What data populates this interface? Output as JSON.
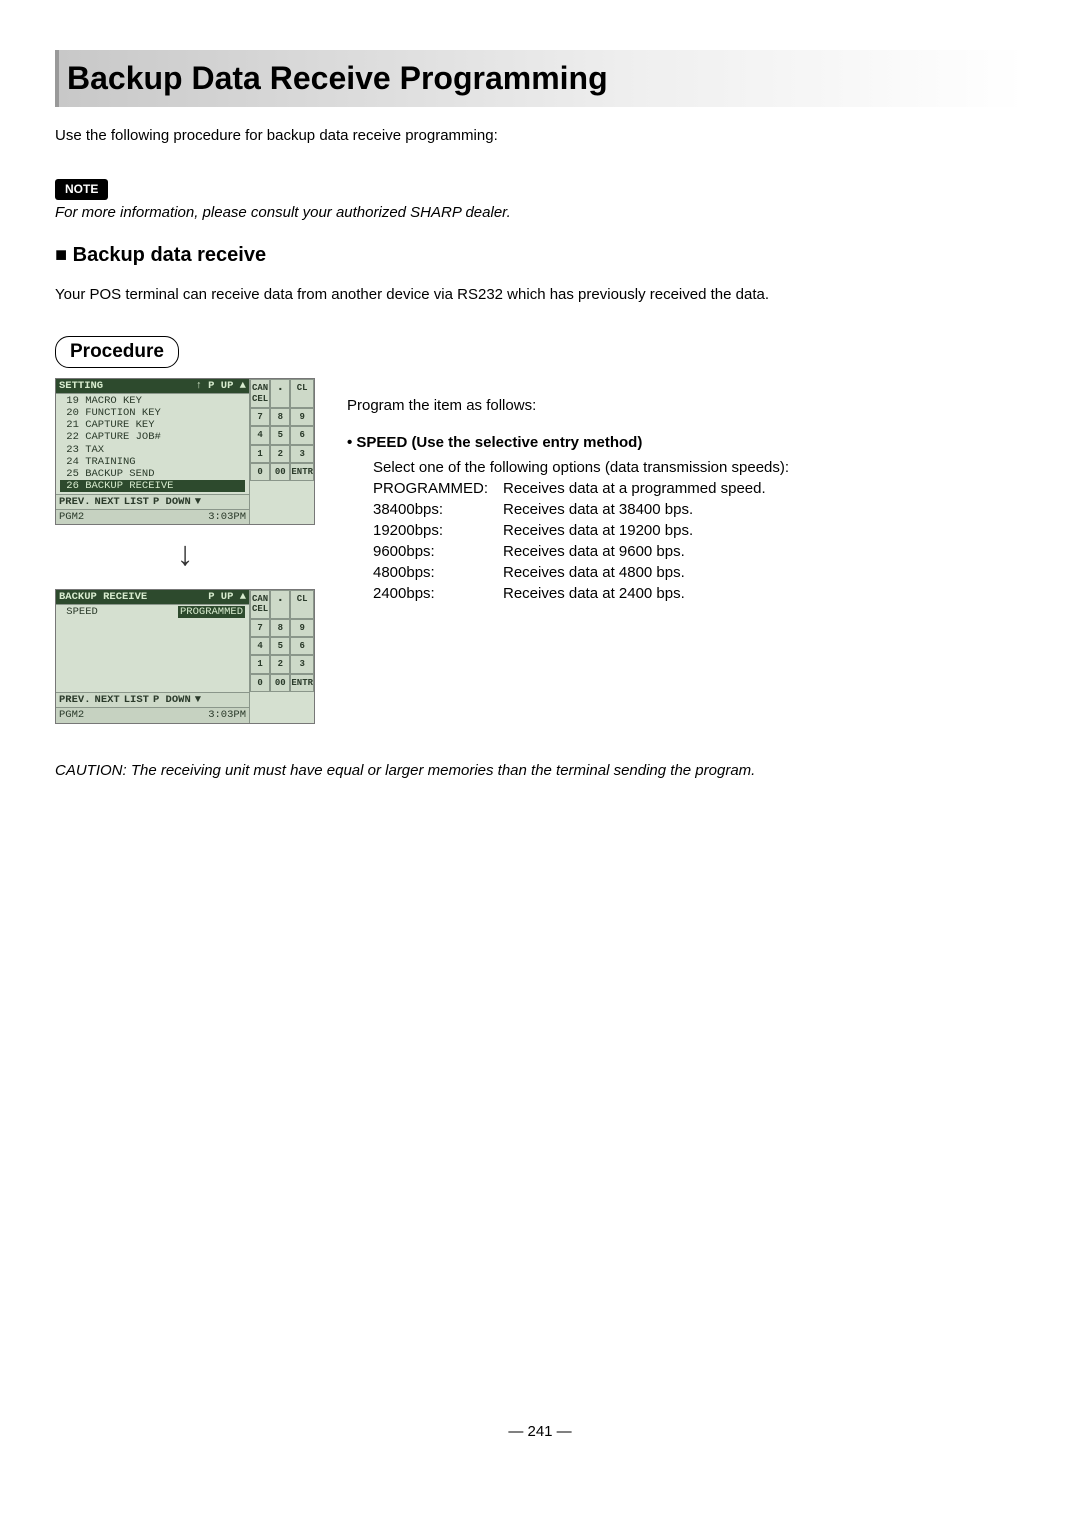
{
  "title": "Backup Data Receive Programming",
  "intro": "Use the following procedure for backup data receive programming:",
  "note_label": "NOTE",
  "note_text": "For more information, please consult your authorized SHARP dealer.",
  "section_heading": "Backup data receive",
  "section_body": "Your POS terminal can receive data from another device via RS232 which has previously received the data.",
  "procedure_label": "Procedure",
  "right": {
    "program_item": "Program the item as follows:",
    "bullet": "• SPEED (Use the selective entry method)",
    "select_line": "Select one of the following options (data transmission speeds):",
    "options": [
      {
        "label": "PROGRAMMED:",
        "desc": "Receives data at a programmed speed."
      },
      {
        "label": "38400bps:",
        "desc": "Receives data at 38400 bps."
      },
      {
        "label": "19200bps:",
        "desc": "Receives data at 19200 bps."
      },
      {
        "label": "9600bps:",
        "desc": "Receives data at 9600 bps."
      },
      {
        "label": "4800bps:",
        "desc": "Receives data at 4800 bps."
      },
      {
        "label": "2400bps:",
        "desc": "Receives data at 2400 bps."
      }
    ]
  },
  "pos1": {
    "header_left": "SETTING",
    "header_right": "↑  P UP  ▲",
    "items": [
      "19 MACRO KEY",
      "20 FUNCTION KEY",
      "21 CAPTURE KEY",
      "22 CAPTURE JOB#",
      "23 TAX",
      "24 TRAINING",
      "25 BACKUP SEND"
    ],
    "selected": "26 BACKUP RECEIVE",
    "foot": [
      "PREV.",
      "NEXT",
      "LIST",
      "P DOWN",
      "▼"
    ],
    "status_left": "PGM2",
    "status_right": "3:03PM",
    "keypad": [
      "CAN\nCEL",
      ".",
      "CL",
      "7",
      "8",
      "9",
      "4",
      "5",
      "6",
      "1",
      "2",
      "3",
      "0",
      "00",
      "ENTR"
    ]
  },
  "pos2": {
    "header_left": "BACKUP RECEIVE",
    "header_right": "P UP  ▲",
    "line_left": " SPEED",
    "line_right": "PROGRAMMED",
    "foot": [
      "PREV.",
      "NEXT",
      "LIST",
      "P DOWN",
      "▼"
    ],
    "status_left": "PGM2",
    "status_right": "3:03PM",
    "keypad": [
      "CAN\nCEL",
      ".",
      "CL",
      "7",
      "8",
      "9",
      "4",
      "5",
      "6",
      "1",
      "2",
      "3",
      "0",
      "00",
      "ENTR"
    ]
  },
  "caution": "CAUTION: The receiving unit must have equal or larger memories than the terminal sending the program.",
  "page_number": "— 241 —"
}
